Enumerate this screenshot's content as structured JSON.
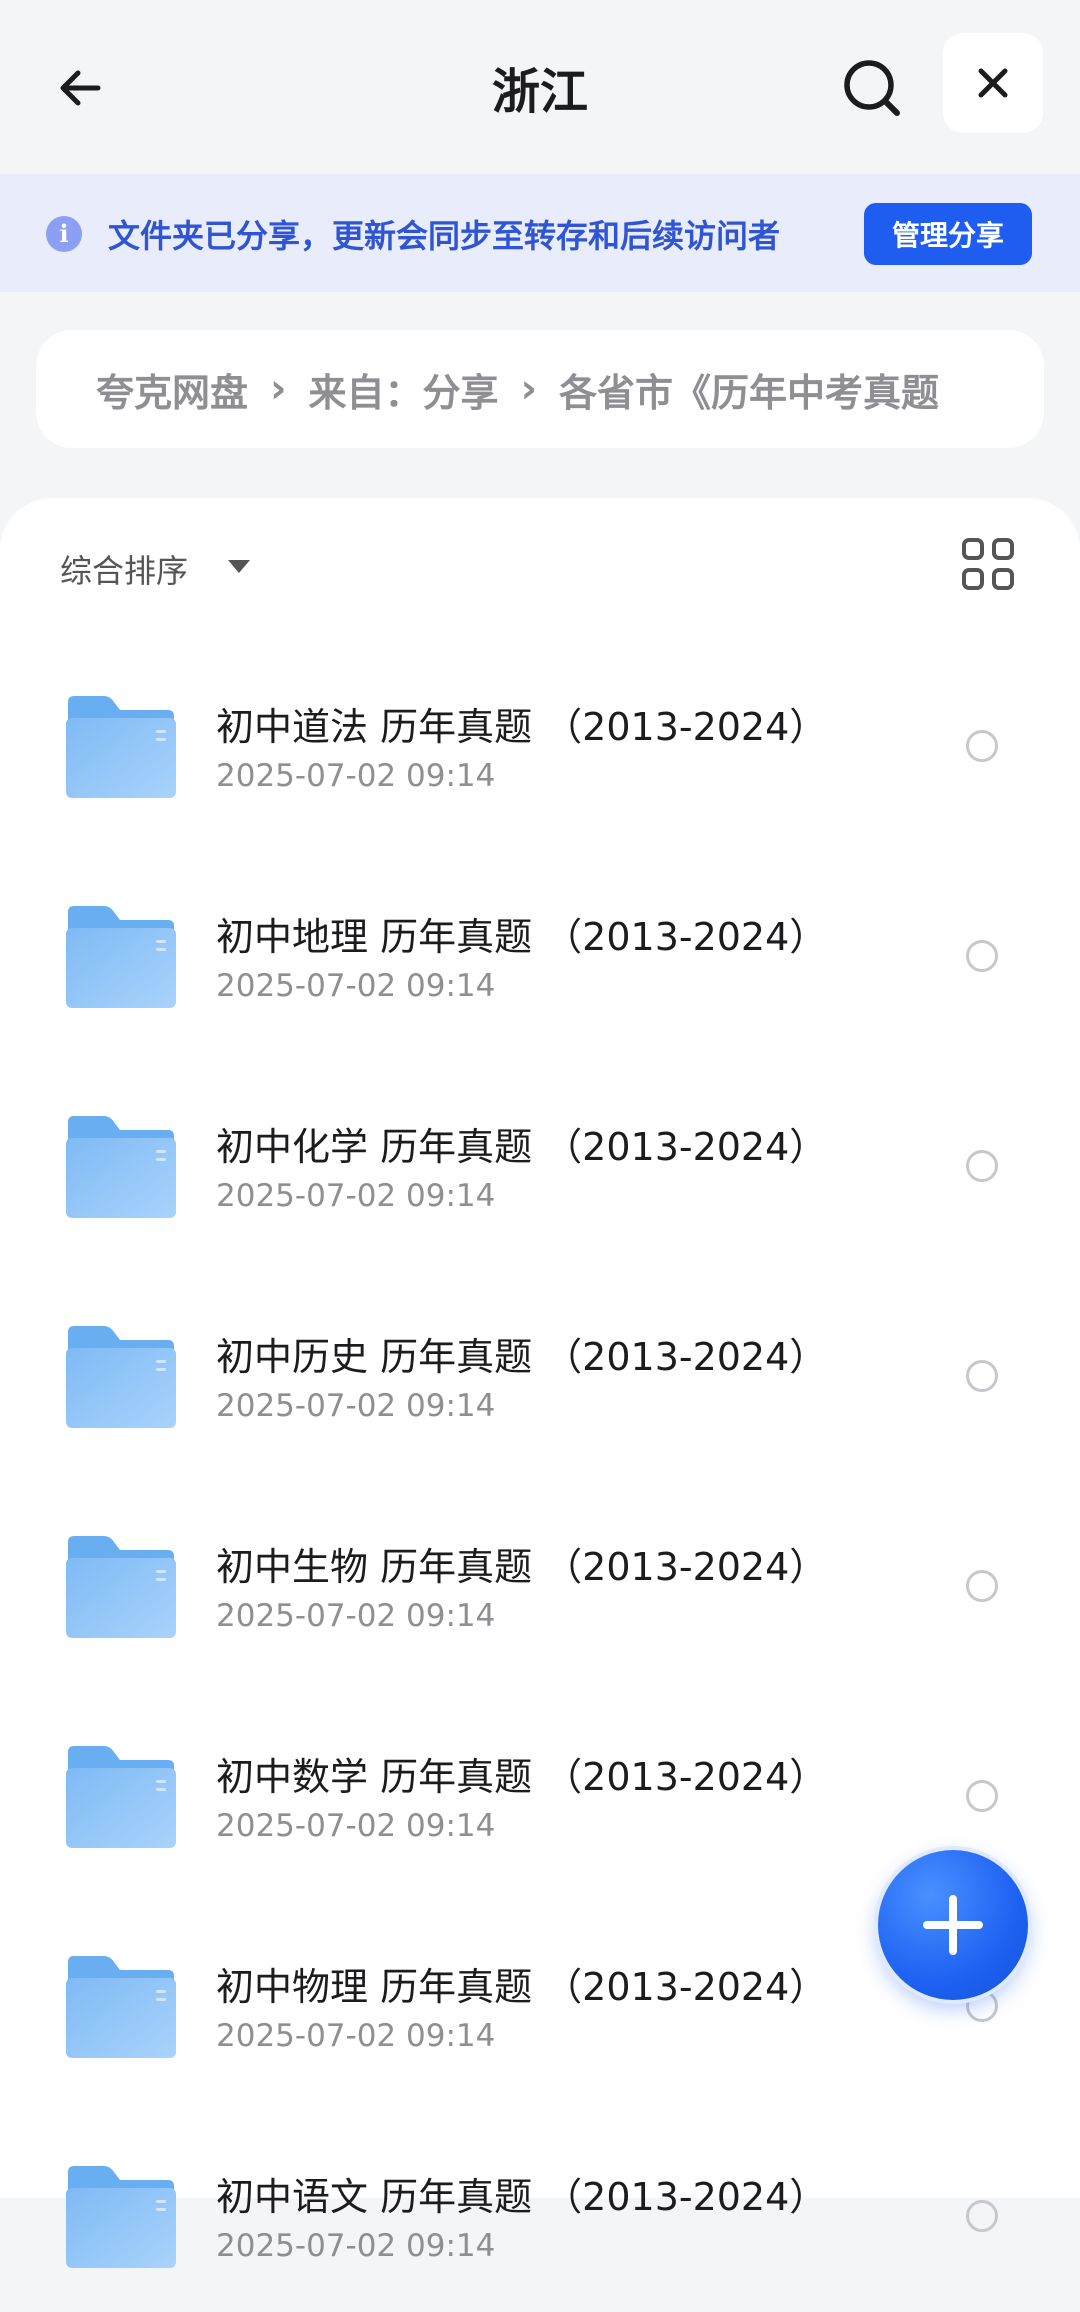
{
  "header": {
    "title": "浙江",
    "icons": {
      "back": "arrow-left-icon",
      "search": "search-icon",
      "close": "close-icon"
    }
  },
  "banner": {
    "text": "文件夹已分享，更新会同步至转存和后续访问者",
    "button_label": "管理分享",
    "icon": "info-icon",
    "info_glyph": "i"
  },
  "breadcrumb": {
    "items": [
      "夸克网盘",
      "来自：分享",
      "各省市《历年中考真题"
    ],
    "separator": "›"
  },
  "toolbar": {
    "sort_label": "综合排序",
    "view_toggle_icon": "grid-view-icon"
  },
  "files": [
    {
      "name": "初中道法 历年真题 （2013-2024）",
      "date": "2025-07-02 09:14"
    },
    {
      "name": "初中地理 历年真题 （2013-2024）",
      "date": "2025-07-02 09:14"
    },
    {
      "name": "初中化学 历年真题 （2013-2024）",
      "date": "2025-07-02 09:14"
    },
    {
      "name": "初中历史 历年真题 （2013-2024）",
      "date": "2025-07-02 09:14"
    },
    {
      "name": "初中生物 历年真题 （2013-2024）",
      "date": "2025-07-02 09:14"
    },
    {
      "name": "初中数学 历年真题 （2013-2024）",
      "date": "2025-07-02 09:14"
    },
    {
      "name": "初中物理 历年真题 （2013-2024）",
      "date": "2025-07-02 09:14"
    },
    {
      "name": "初中语文 历年真题 （2013-2024）",
      "date": "2025-07-02 09:14"
    }
  ],
  "fab": {
    "icon": "plus-icon"
  },
  "colors": {
    "accent": "#1f5cf0",
    "banner_bg": "#e9ecfa",
    "banner_text": "#2f55d4",
    "folder": "#8cc3f7"
  }
}
